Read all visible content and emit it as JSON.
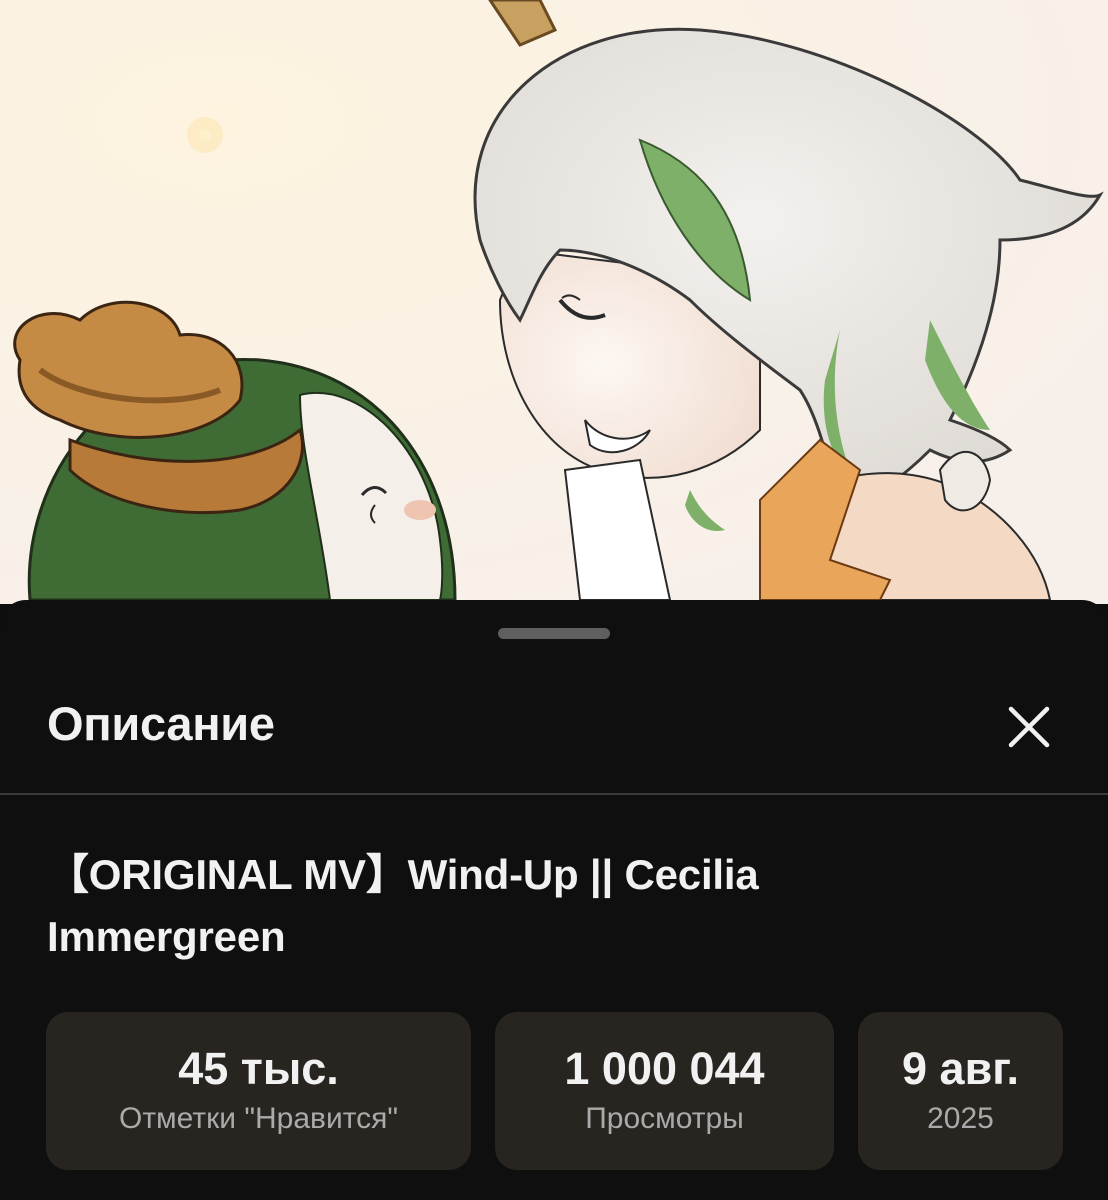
{
  "sheet": {
    "title": "Описание",
    "close_icon": "close-icon"
  },
  "video": {
    "title": "【ORIGINAL MV】Wind-Up || Cecilia Immergreen"
  },
  "stats": {
    "likes": {
      "value": "45 тыс.",
      "label": "Отметки \"Нравится\""
    },
    "views": {
      "value": "1 000 044",
      "label": "Просмотры"
    },
    "date": {
      "value": "9 авг.",
      "label": "2025"
    }
  },
  "colors": {
    "background": "#0f0f0f",
    "card": "#282520",
    "text_primary": "#f1f1f1",
    "text_secondary": "#aaaaaa"
  }
}
